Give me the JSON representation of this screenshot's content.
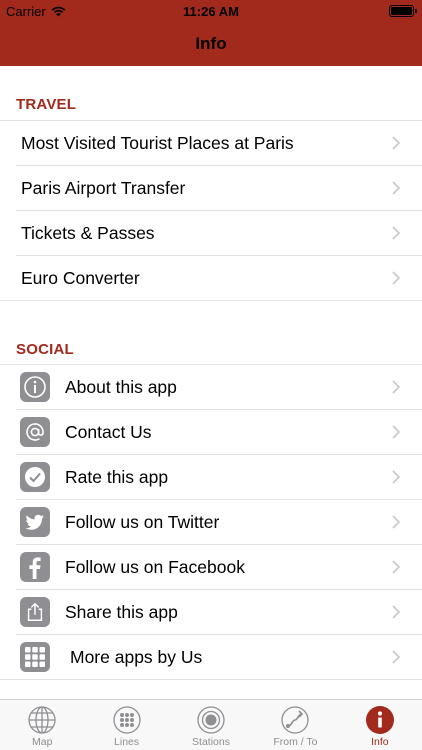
{
  "status_bar": {
    "carrier": "Carrier",
    "time": "11:26 AM"
  },
  "nav": {
    "title": "Info"
  },
  "travel": {
    "title": "TRAVEL",
    "items": [
      {
        "label": "Most Visited Tourist Places at Paris"
      },
      {
        "label": "Paris Airport Transfer"
      },
      {
        "label": "Tickets & Passes"
      },
      {
        "label": "Euro Converter"
      }
    ]
  },
  "social": {
    "title": "SOCIAL",
    "items": [
      {
        "label": "About this app",
        "icon": "info-icon"
      },
      {
        "label": "Contact Us",
        "icon": "at-sign-icon"
      },
      {
        "label": "Rate this app",
        "icon": "checkmark-icon"
      },
      {
        "label": "Follow us on Twitter",
        "icon": "twitter-icon"
      },
      {
        "label": "Follow us on Facebook",
        "icon": "facebook-icon"
      },
      {
        "label": "Share this app",
        "icon": "share-icon"
      },
      {
        "label": "More apps by Us",
        "icon": "grid-icon"
      }
    ]
  },
  "tabbar": {
    "tabs": [
      {
        "label": "Map",
        "icon": "globe-icon"
      },
      {
        "label": "Lines",
        "icon": "dots-grid-icon"
      },
      {
        "label": "Stations",
        "icon": "target-icon"
      },
      {
        "label": "From / To",
        "icon": "route-icon"
      },
      {
        "label": "Info",
        "icon": "info-icon",
        "active": true
      }
    ]
  },
  "colors": {
    "accent": "#a12a1c",
    "icon_bg": "#8e8e93",
    "separator": "#e2e2e2"
  }
}
